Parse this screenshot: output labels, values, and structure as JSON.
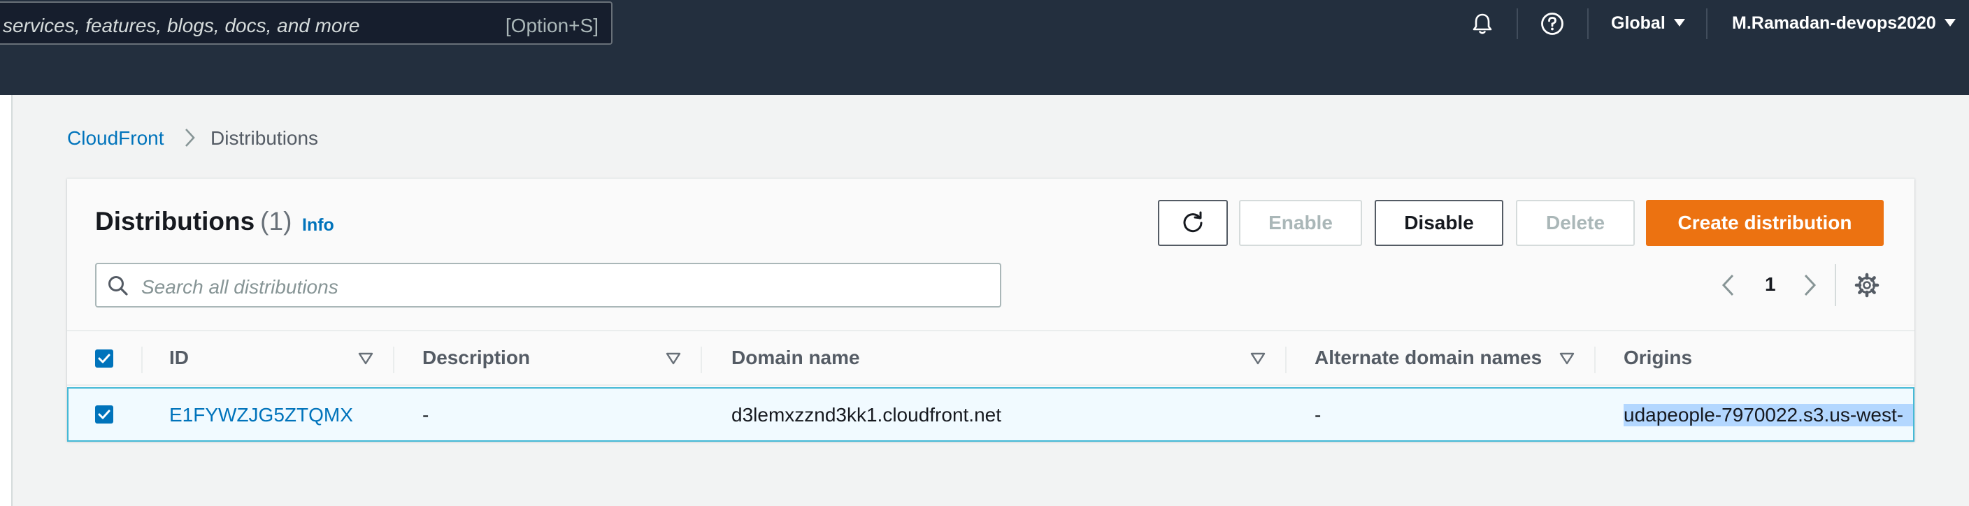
{
  "topnav": {
    "search_placeholder": "services, features, blogs, docs, and more",
    "search_shortcut": "[Option+S]",
    "icons": [
      "bell-icon",
      "help-icon"
    ],
    "region_label": "Global",
    "account_label": "M.Ramadan-devops2020"
  },
  "breadcrumb": {
    "root": "CloudFront",
    "current": "Distributions"
  },
  "panel": {
    "title": "Distributions",
    "count": "(1)",
    "info_label": "Info",
    "buttons": {
      "enable": "Enable",
      "disable": "Disable",
      "delete": "Delete",
      "create": "Create distribution"
    },
    "search_placeholder": "Search all distributions",
    "pagination": {
      "current_page": "1"
    }
  },
  "table": {
    "columns": [
      "ID",
      "Description",
      "Domain name",
      "Alternate domain names",
      "Origins"
    ],
    "header_checkbox_checked": true,
    "rows": [
      {
        "selected": true,
        "id": "E1FYWZJG5ZTQMX",
        "description": "-",
        "domain_name": "d3lemxzznd3kk1.cloudfront.net",
        "alternate_domain_names": "-",
        "origins": "udapeople-7970022.s3.us-west-"
      }
    ]
  },
  "colors": {
    "nav_background": "#232f3e",
    "link": "#0073bb",
    "primary_button": "#ec7211",
    "selected_row_border": "#44b9d6",
    "selected_row_background": "#f1faff"
  }
}
